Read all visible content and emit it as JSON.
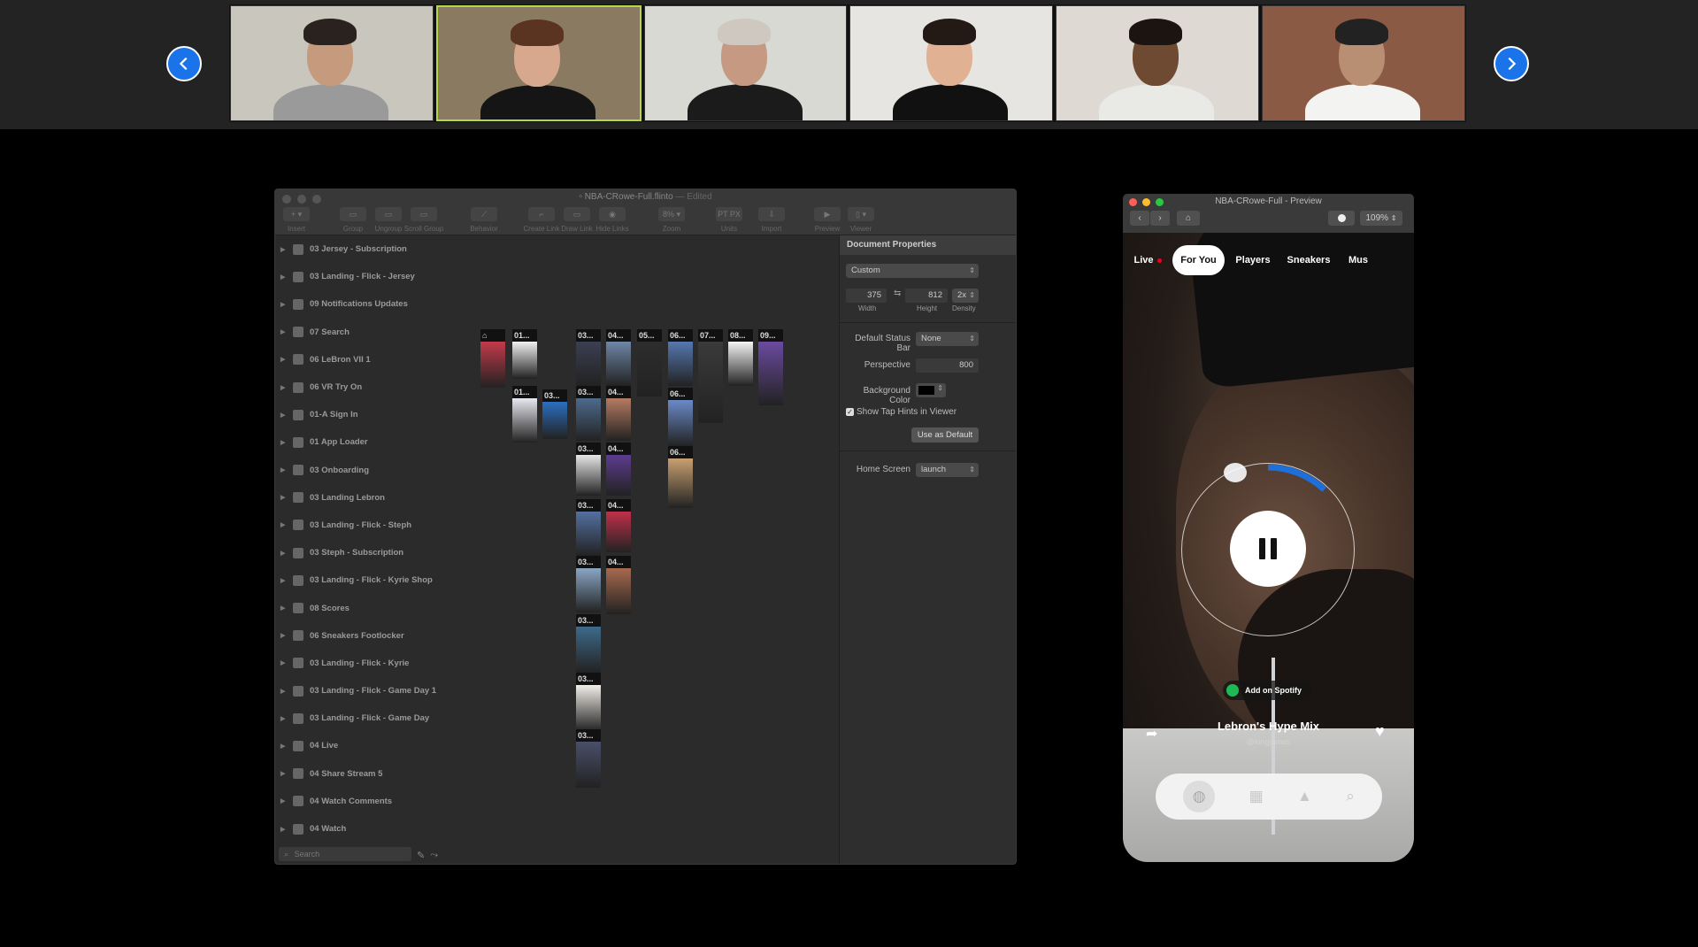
{
  "meeting": {
    "nav_prev": "previous-page",
    "nav_next": "next-page",
    "participants": [
      {
        "wall": "#c9c6bd",
        "skin": "#c59a7d",
        "shirt": "#9a9a9a",
        "hair": "#2a221e",
        "active": false
      },
      {
        "wall": "#8b7a62",
        "skin": "#d8a88e",
        "shirt": "#151515",
        "hair": "#5a3421",
        "active": true
      },
      {
        "wall": "#d9d9d3",
        "skin": "#c69a82",
        "shirt": "#1b1b1b",
        "hair": "#cfc8c0",
        "active": false
      },
      {
        "wall": "#e7e5e2",
        "skin": "#e0b193",
        "shirt": "#111111",
        "hair": "#231915",
        "active": false
      },
      {
        "wall": "#dedad3",
        "skin": "#6f4a33",
        "shirt": "#e9e9e6",
        "hair": "#1c1410",
        "active": false
      },
      {
        "wall": "#8a5a45",
        "skin": "#b98f74",
        "shirt": "#f3f3f1",
        "hair": "#222222",
        "active": false
      }
    ]
  },
  "flinto": {
    "window_title": "NBA-CRowe-Full.flinto",
    "window_status": "— Edited",
    "toolbar": [
      {
        "label": "Insert",
        "icon": "+ ▾"
      },
      {
        "label": "Group",
        "icon": "▭"
      },
      {
        "label": "Ungroup",
        "icon": "▭"
      },
      {
        "label": "Scroll Group",
        "icon": "▭"
      },
      {
        "label": "Behavior",
        "icon": "⟋"
      },
      {
        "label": "Create Link",
        "icon": "⌐"
      },
      {
        "label": "Draw Link",
        "icon": "▭"
      },
      {
        "label": "Hide Links",
        "icon": "◉"
      },
      {
        "label": "Zoom",
        "icon": "8% ▾"
      },
      {
        "label": "Units",
        "icon": "PT PX"
      },
      {
        "label": "Import",
        "icon": "⇩"
      },
      {
        "label": "Preview",
        "icon": "▶"
      },
      {
        "label": "Viewer",
        "icon": "▯ ▾"
      }
    ],
    "layers": [
      "03 Jersey - Subscription",
      "03 Landing - Flick - Jersey",
      "09 Notifications Updates",
      "07 Search",
      "06 LeBron VII 1",
      "06 VR Try On",
      "01-A Sign In",
      "01 App Loader",
      "03 Onboarding",
      "03 Landing Lebron",
      "03 Landing - Flick - Steph",
      "03 Steph - Subscription",
      "03 Landing - Flick - Kyrie Shop",
      "08 Scores",
      "06 Sneakers Footlocker",
      "03 Landing - Flick - Kyrie",
      "03 Landing - Flick - Game Day 1",
      "03 Landing - Flick - Game Day",
      "04 Live",
      "04 Share Stream 5",
      "04 Watch Comments",
      "04 Watch"
    ],
    "search_placeholder": "Search",
    "canvas_screens": [
      {
        "label": "⌂",
        "color": "#c23a4a"
      },
      {
        "label": "01...",
        "color": "#f0f0f0"
      },
      {
        "label": "01...",
        "color": "#e8e8f0"
      },
      {
        "label": "03...",
        "color": "#2a6fc0"
      },
      {
        "label": "03...",
        "color": "#3b3f52"
      },
      {
        "label": "03...",
        "color": "#4d6b8c"
      },
      {
        "label": "03...",
        "color": "#e6e6e6"
      },
      {
        "label": "03...",
        "color": "#5470a0"
      },
      {
        "label": "03...",
        "color": "#8aa6c4"
      },
      {
        "label": "03...",
        "color": "#3e6a8a"
      },
      {
        "label": "03...",
        "color": "#f2eee8"
      },
      {
        "label": "03...",
        "color": "#4a4f6a"
      },
      {
        "label": "04...",
        "color": "#6e86a6"
      },
      {
        "label": "04...",
        "color": "#b57b62"
      },
      {
        "label": "04...",
        "color": "#5d3c8e"
      },
      {
        "label": "04...",
        "color": "#c0304a"
      },
      {
        "label": "04...",
        "color": "#a86a4e"
      },
      {
        "label": "05...",
        "color": "#2d2d2d"
      },
      {
        "label": "06...",
        "color": "#5578b0"
      },
      {
        "label": "06...",
        "color": "#6a8ac8"
      },
      {
        "label": "06...",
        "color": "#c8a070"
      },
      {
        "label": "07...",
        "color": "#3a3a3a"
      },
      {
        "label": "08...",
        "color": "#f4f4f4"
      },
      {
        "label": "09...",
        "color": "#6b4aa0"
      }
    ],
    "properties": {
      "header": "Document Properties",
      "device": "Custom",
      "width": "375",
      "height": "812",
      "density": "2x",
      "width_label": "Width",
      "height_label": "Height",
      "density_label": "Density",
      "status_bar_label": "Default Status Bar",
      "status_bar_value": "None",
      "perspective_label": "Perspective",
      "perspective_value": "800",
      "bg_color_label": "Background Color",
      "tap_hints_label": "Show Tap Hints in Viewer",
      "use_default_label": "Use as Default",
      "home_screen_label": "Home Screen",
      "home_screen_value": "launch"
    }
  },
  "preview": {
    "window_title": "NBA-CRowe-Full - Preview",
    "zoom": "109%",
    "tabs": [
      "Live",
      "For You",
      "Players",
      "Sneakers",
      "Mus"
    ],
    "active_tab": "For You",
    "spotify_label": "Add on Spotify",
    "track_title": "Lebron's Hype Mix",
    "track_subtitle": "@kingjames",
    "progress_fraction": 0.12
  }
}
